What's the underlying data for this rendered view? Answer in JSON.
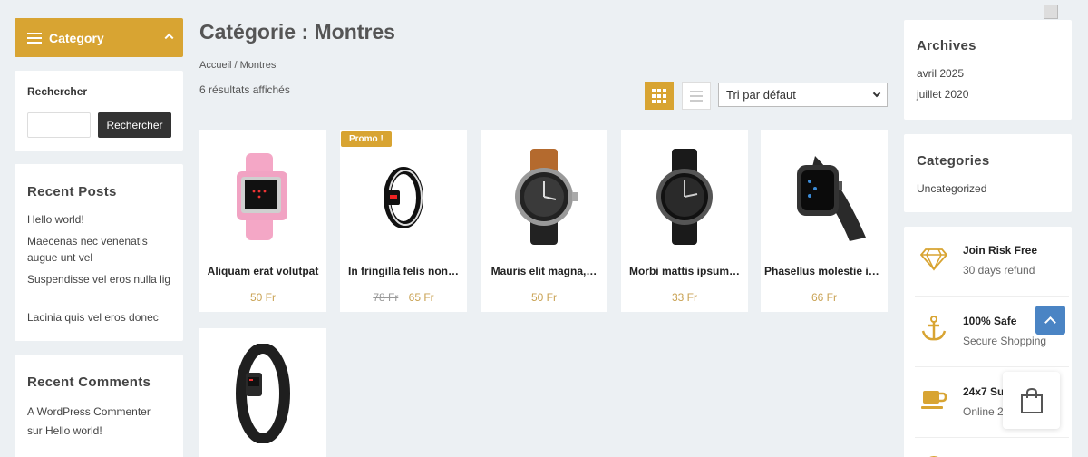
{
  "left_sidebar": {
    "category_label": "Category",
    "search": {
      "title": "Rechercher",
      "value": "",
      "button_label": "Rechercher"
    },
    "recent_posts": {
      "title": "Recent Posts",
      "items": [
        "Hello world!",
        "Maecenas nec venenatis augue unt vel",
        "Suspendisse vel eros nulla lig",
        "Lacinia quis vel eros donec"
      ]
    },
    "recent_comments": {
      "title": "Recent Comments",
      "items": [
        "A WordPress Commenter sur Hello world!"
      ]
    }
  },
  "main": {
    "title": "Catégorie : Montres",
    "breadcrumb": "Accueil / Montres",
    "results_count": "6 résultats affichés",
    "sort": {
      "selected": "Tri par défaut"
    },
    "products": [
      {
        "name": "Aliquam erat volutpat",
        "price": "50 Fr",
        "old_price": "",
        "badge": ""
      },
      {
        "name": "In fringilla felis non…",
        "price": "65 Fr",
        "old_price": "78 Fr",
        "badge": "Promo !"
      },
      {
        "name": "Mauris elit magna,…",
        "price": "50 Fr",
        "old_price": "",
        "badge": ""
      },
      {
        "name": "Morbi mattis ipsum…",
        "price": "33 Fr",
        "old_price": "",
        "badge": ""
      },
      {
        "name": "Phasellus molestie id…",
        "price": "66 Fr",
        "old_price": "",
        "badge": ""
      },
      {
        "name": "",
        "price": "",
        "old_price": "",
        "badge": ""
      }
    ]
  },
  "right_sidebar": {
    "archives": {
      "title": "Archives",
      "items": [
        "avril 2025",
        "juillet 2020"
      ]
    },
    "categories": {
      "title": "Categories",
      "items": [
        "Uncategorized"
      ]
    },
    "features": [
      {
        "title": "Join Risk Free",
        "subtitle": "30 days refund",
        "icon": "diamond-icon"
      },
      {
        "title": "100% Safe",
        "subtitle": "Secure Shopping",
        "icon": "anchor-icon"
      },
      {
        "title": "24x7 Su",
        "subtitle": "Online 2",
        "icon": "coffee-cup-icon"
      }
    ]
  },
  "colors": {
    "accent": "#d8a432",
    "price": "#c9a253",
    "scroll_top": "#4a84c4"
  }
}
